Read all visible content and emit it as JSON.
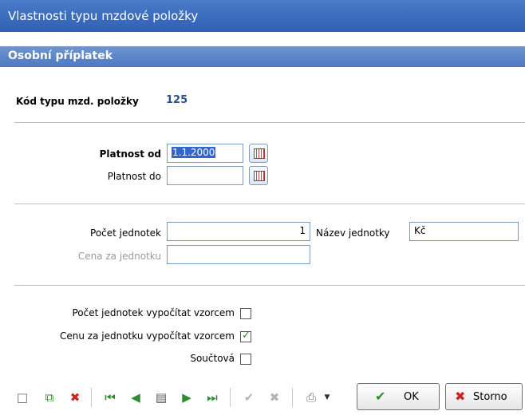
{
  "window": {
    "title": "Vlastnosti typu mzdové položky",
    "subtitle": "Osobní příplatek"
  },
  "code": {
    "label": "Kód typu mzd. položky",
    "value": "125"
  },
  "validity": {
    "from_label": "Platnost od",
    "from_value": "1.1.2000",
    "to_label": "Platnost do",
    "to_value": ""
  },
  "units": {
    "count_label": "Počet jednotek",
    "count_value": "1",
    "unit_name_label": "Název jednotky",
    "unit_name_value": "Kč",
    "price_label": "Cena za jednotku",
    "price_value": ""
  },
  "options": {
    "calc_count_label": "Počet jednotek vypočítat vzorcem",
    "calc_count_checked": false,
    "calc_price_label": "Cenu za jednotku vypočítat vzorcem",
    "calc_price_checked": true,
    "sum_label": "Součtová",
    "sum_checked": false
  },
  "toolbar": {
    "icons": [
      "new-document-icon",
      "copy-document-icon",
      "delete-document-icon",
      "first-record-icon",
      "previous-record-icon",
      "list-icon",
      "next-record-icon",
      "last-record-icon",
      "confirm-icon",
      "cancel-icon",
      "print-icon"
    ],
    "ok_label": "OK",
    "cancel_label": "Storno"
  }
}
